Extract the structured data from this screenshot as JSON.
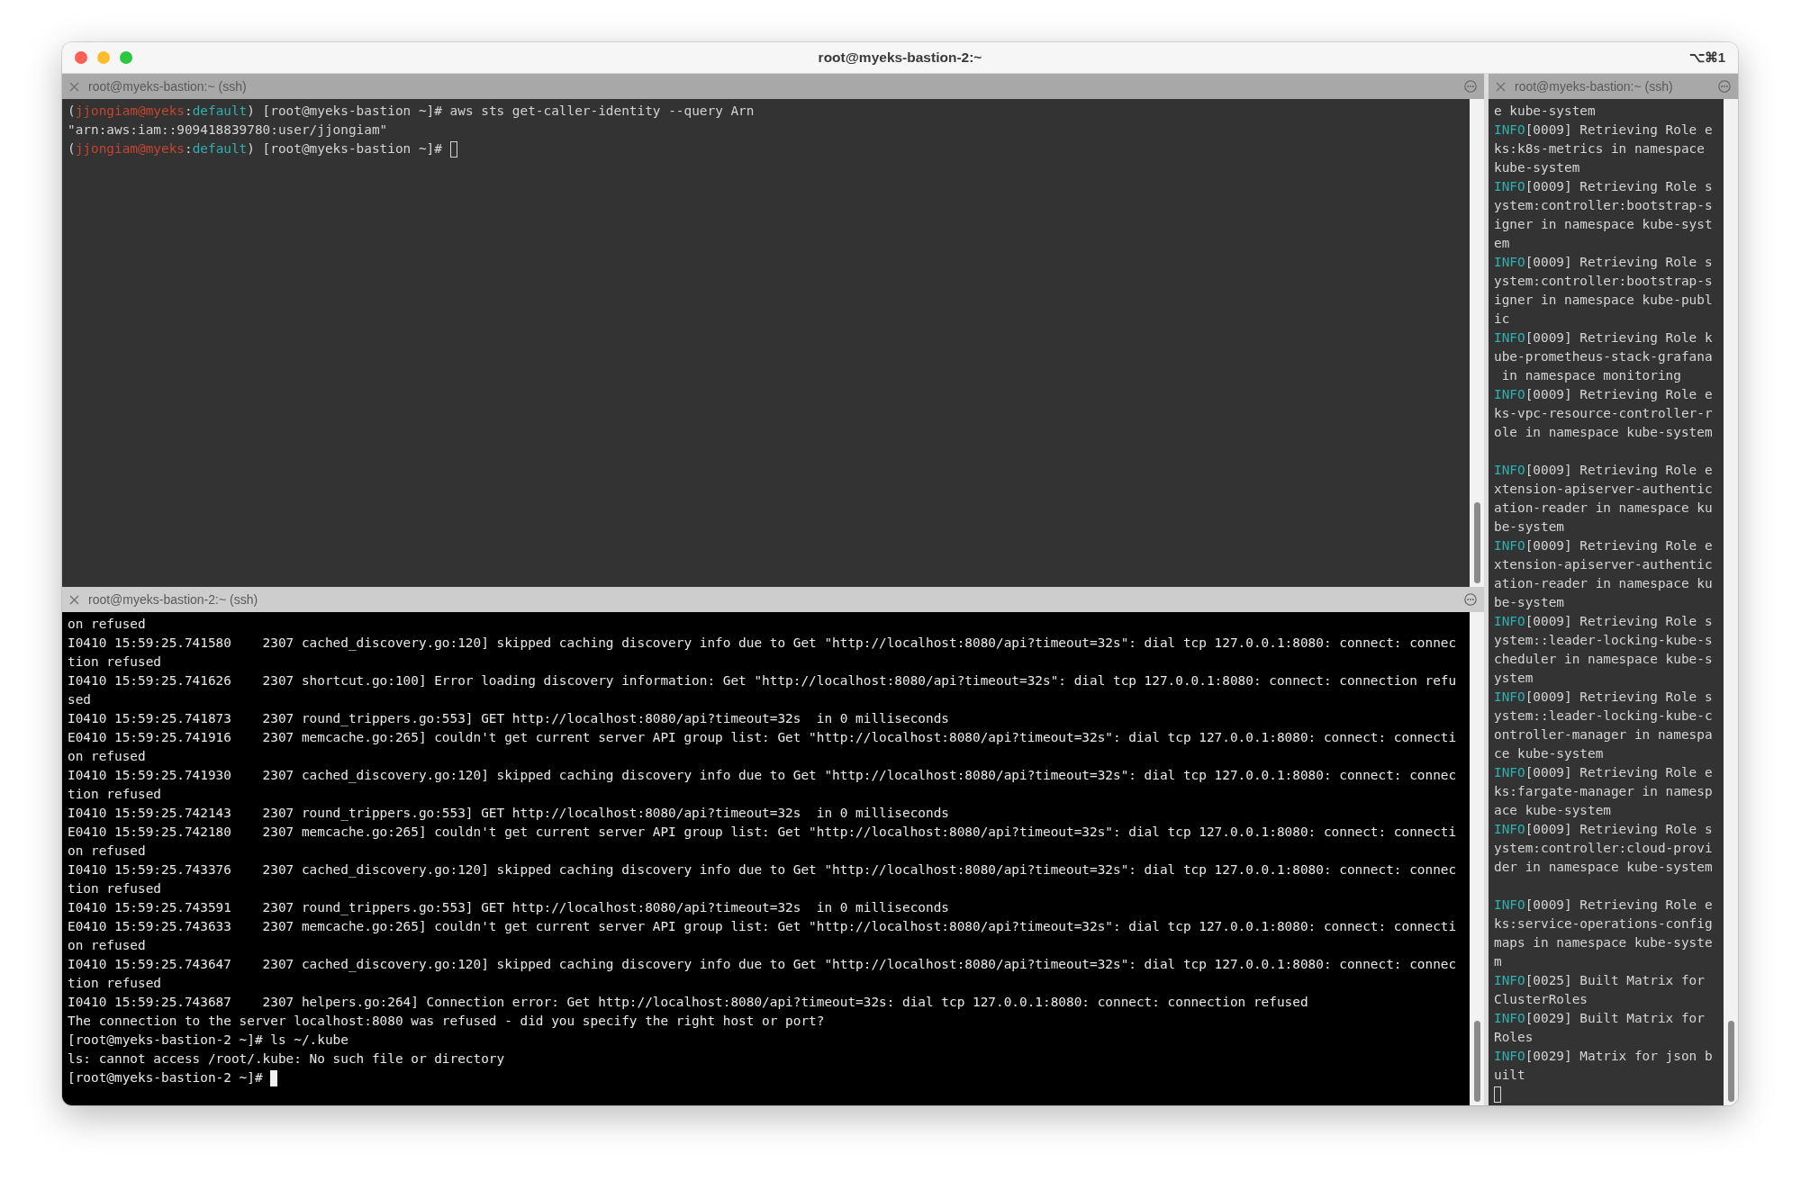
{
  "window": {
    "title": "root@myeks-bastion-2:~",
    "shortcut": "⌥⌘1"
  },
  "panes": [
    {
      "tab_title": "root@myeks-bastion:~ (ssh)",
      "focused": false,
      "lines": [
        {
          "kind": "segments",
          "segments": [
            {
              "kind": "plain",
              "text": "("
            },
            {
              "kind": "user",
              "text": "jjongiam@myeks"
            },
            {
              "kind": "plain",
              "text": ":"
            },
            {
              "kind": "context",
              "text": "default"
            },
            {
              "kind": "plain",
              "text": ") [root@myeks-bastion ~]# aws sts get-caller-identity --query Arn"
            }
          ]
        },
        "\"arn:aws:iam::909418839780:user/jjongiam\"",
        {
          "kind": "segments",
          "cursor": true,
          "segments": [
            {
              "kind": "plain",
              "text": "("
            },
            {
              "kind": "user",
              "text": "jjongiam@myeks"
            },
            {
              "kind": "plain",
              "text": ":"
            },
            {
              "kind": "context",
              "text": "default"
            },
            {
              "kind": "plain",
              "text": ") [root@myeks-bastion ~]# "
            }
          ]
        }
      ]
    },
    {
      "tab_title": "root@myeks-bastion-2:~ (ssh)",
      "focused": true,
      "lines": [
        "on refused",
        "I0410 15:59:25.741580    2307 cached_discovery.go:120] skipped caching discovery info due to Get \"http://localhost:8080/api?timeout=32s\": dial tcp 127.0.0.1:8080: connect: connec",
        "tion refused",
        "I0410 15:59:25.741626    2307 shortcut.go:100] Error loading discovery information: Get \"http://localhost:8080/api?timeout=32s\": dial tcp 127.0.0.1:8080: connect: connection refu",
        "sed",
        "I0410 15:59:25.741873    2307 round_trippers.go:553] GET http://localhost:8080/api?timeout=32s  in 0 milliseconds",
        "E0410 15:59:25.741916    2307 memcache.go:265] couldn't get current server API group list: Get \"http://localhost:8080/api?timeout=32s\": dial tcp 127.0.0.1:8080: connect: connecti",
        "on refused",
        "I0410 15:59:25.741930    2307 cached_discovery.go:120] skipped caching discovery info due to Get \"http://localhost:8080/api?timeout=32s\": dial tcp 127.0.0.1:8080: connect: connec",
        "tion refused",
        "I0410 15:59:25.742143    2307 round_trippers.go:553] GET http://localhost:8080/api?timeout=32s  in 0 milliseconds",
        "E0410 15:59:25.742180    2307 memcache.go:265] couldn't get current server API group list: Get \"http://localhost:8080/api?timeout=32s\": dial tcp 127.0.0.1:8080: connect: connecti",
        "on refused",
        "I0410 15:59:25.743376    2307 cached_discovery.go:120] skipped caching discovery info due to Get \"http://localhost:8080/api?timeout=32s\": dial tcp 127.0.0.1:8080: connect: connec",
        "tion refused",
        "I0410 15:59:25.743591    2307 round_trippers.go:553] GET http://localhost:8080/api?timeout=32s  in 0 milliseconds",
        "E0410 15:59:25.743633    2307 memcache.go:265] couldn't get current server API group list: Get \"http://localhost:8080/api?timeout=32s\": dial tcp 127.0.0.1:8080: connect: connecti",
        "on refused",
        "I0410 15:59:25.743647    2307 cached_discovery.go:120] skipped caching discovery info due to Get \"http://localhost:8080/api?timeout=32s\": dial tcp 127.0.0.1:8080: connect: connec",
        "tion refused",
        "I0410 15:59:25.743687    2307 helpers.go:264] Connection error: Get http://localhost:8080/api?timeout=32s: dial tcp 127.0.0.1:8080: connect: connection refused",
        "The connection to the server localhost:8080 was refused - did you specify the right host or port?",
        "[root@myeks-bastion-2 ~]# ls ~/.kube",
        "ls: cannot access /root/.kube: No such file or directory",
        {
          "kind": "segments",
          "cursor": true,
          "segments": [
            {
              "kind": "plain",
              "text": "[root@myeks-bastion-2 ~]# "
            }
          ]
        }
      ]
    },
    {
      "tab_title": "root@myeks-bastion:~ (ssh)",
      "focused": false,
      "lines": [
        "e kube-system",
        {
          "kind": "segments",
          "segments": [
            {
              "kind": "info",
              "text": "INFO"
            },
            {
              "kind": "plain",
              "text": "[0009] Retrieving Role e"
            }
          ]
        },
        "ks:k8s-metrics in namespace",
        "kube-system",
        {
          "kind": "segments",
          "segments": [
            {
              "kind": "info",
              "text": "INFO"
            },
            {
              "kind": "plain",
              "text": "[0009] Retrieving Role s"
            }
          ]
        },
        "ystem:controller:bootstrap-s",
        "igner in namespace kube-syst",
        "em",
        {
          "kind": "segments",
          "segments": [
            {
              "kind": "info",
              "text": "INFO"
            },
            {
              "kind": "plain",
              "text": "[0009] Retrieving Role s"
            }
          ]
        },
        "ystem:controller:bootstrap-s",
        "igner in namespace kube-publ",
        "ic",
        {
          "kind": "segments",
          "segments": [
            {
              "kind": "info",
              "text": "INFO"
            },
            {
              "kind": "plain",
              "text": "[0009] Retrieving Role k"
            }
          ]
        },
        "ube-prometheus-stack-grafana",
        " in namespace monitoring",
        {
          "kind": "segments",
          "segments": [
            {
              "kind": "info",
              "text": "INFO"
            },
            {
              "kind": "plain",
              "text": "[0009] Retrieving Role e"
            }
          ]
        },
        "ks-vpc-resource-controller-r",
        "ole in namespace kube-system",
        {
          "kind": "blank"
        },
        {
          "kind": "segments",
          "segments": [
            {
              "kind": "info",
              "text": "INFO"
            },
            {
              "kind": "plain",
              "text": "[0009] Retrieving Role e"
            }
          ]
        },
        "xtension-apiserver-authentic",
        "ation-reader in namespace ku",
        "be-system",
        {
          "kind": "segments",
          "segments": [
            {
              "kind": "info",
              "text": "INFO"
            },
            {
              "kind": "plain",
              "text": "[0009] Retrieving Role e"
            }
          ]
        },
        "xtension-apiserver-authentic",
        "ation-reader in namespace ku",
        "be-system",
        {
          "kind": "segments",
          "segments": [
            {
              "kind": "info",
              "text": "INFO"
            },
            {
              "kind": "plain",
              "text": "[0009] Retrieving Role s"
            }
          ]
        },
        "ystem::leader-locking-kube-s",
        "cheduler in namespace kube-s",
        "ystem",
        {
          "kind": "segments",
          "segments": [
            {
              "kind": "info",
              "text": "INFO"
            },
            {
              "kind": "plain",
              "text": "[0009] Retrieving Role s"
            }
          ]
        },
        "ystem::leader-locking-kube-c",
        "ontroller-manager in namespa",
        "ce kube-system",
        {
          "kind": "segments",
          "segments": [
            {
              "kind": "info",
              "text": "INFO"
            },
            {
              "kind": "plain",
              "text": "[0009] Retrieving Role e"
            }
          ]
        },
        "ks:fargate-manager in namesp",
        "ace kube-system",
        {
          "kind": "segments",
          "segments": [
            {
              "kind": "info",
              "text": "INFO"
            },
            {
              "kind": "plain",
              "text": "[0009] Retrieving Role s"
            }
          ]
        },
        "ystem:controller:cloud-provi",
        "der in namespace kube-system",
        {
          "kind": "blank"
        },
        {
          "kind": "segments",
          "segments": [
            {
              "kind": "info",
              "text": "INFO"
            },
            {
              "kind": "plain",
              "text": "[0009] Retrieving Role e"
            }
          ]
        },
        "ks:service-operations-config",
        "maps in namespace kube-syste",
        "m",
        {
          "kind": "segments",
          "segments": [
            {
              "kind": "info",
              "text": "INFO"
            },
            {
              "kind": "plain",
              "text": "[0025] Built Matrix for"
            }
          ]
        },
        "ClusterRoles",
        {
          "kind": "segments",
          "segments": [
            {
              "kind": "info",
              "text": "INFO"
            },
            {
              "kind": "plain",
              "text": "[0029] Built Matrix for"
            }
          ]
        },
        "Roles",
        {
          "kind": "segments",
          "segments": [
            {
              "kind": "info",
              "text": "INFO"
            },
            {
              "kind": "plain",
              "text": "[0029] Matrix for json b"
            }
          ]
        },
        "uilt",
        {
          "kind": "blank",
          "cursor": true
        }
      ]
    }
  ]
}
